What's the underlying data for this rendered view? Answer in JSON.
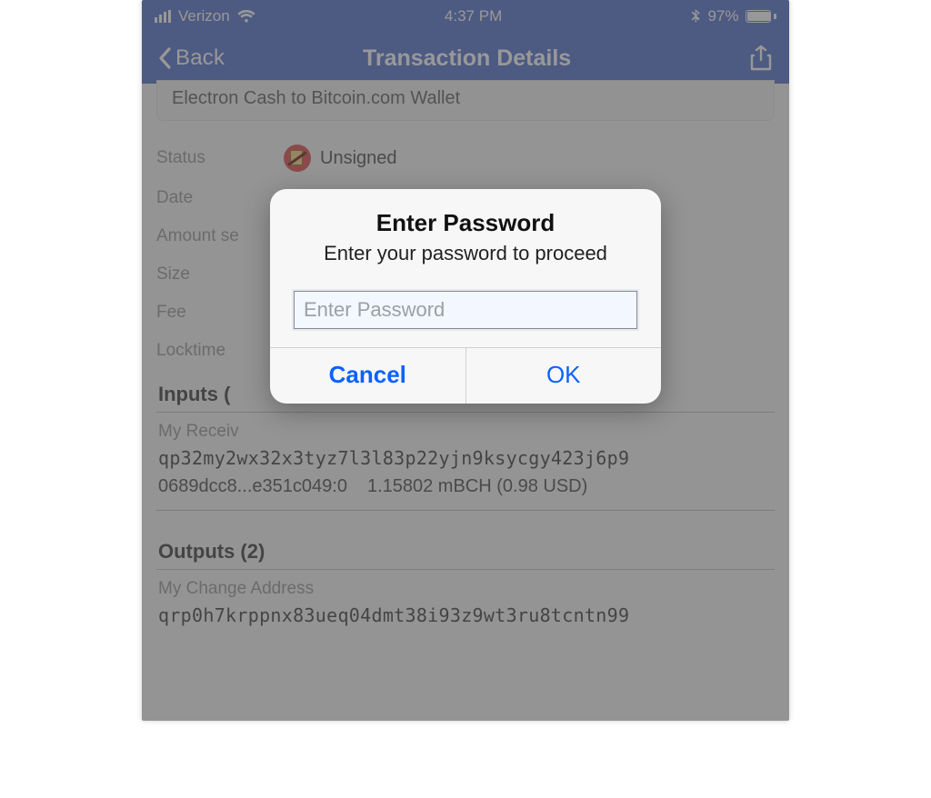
{
  "statusbar": {
    "carrier": "Verizon",
    "time": "4:37 PM",
    "battery_pct": "97%"
  },
  "navbar": {
    "back_label": "Back",
    "title": "Transaction Details"
  },
  "tx": {
    "description": "Electron Cash to Bitcoin.com Wallet",
    "labels": {
      "status": "Status",
      "date": "Date",
      "amount": "Amount se",
      "size": "Size",
      "fee": "Fee",
      "locktime": "Locktime"
    },
    "status_value": "Unsigned"
  },
  "inputs": {
    "heading_prefix": "Inputs (",
    "sub_label": "My Receiv",
    "address": "qp32my2wx32x3tyz7l3l83p22yjn9ksycgy423j6p9",
    "txid": "0689dcc8...e351c049:0",
    "amount": "1.15802 mBCH (0.98 USD)"
  },
  "outputs": {
    "heading": "Outputs (2)",
    "sub_label": "My Change Address",
    "address": "qrp0h7krppnx83ueq04dmt38i93z9wt3ru8tcntn99"
  },
  "modal": {
    "title": "Enter Password",
    "message": "Enter your password to proceed",
    "placeholder": "Enter Password",
    "cancel": "Cancel",
    "ok": "OK"
  }
}
